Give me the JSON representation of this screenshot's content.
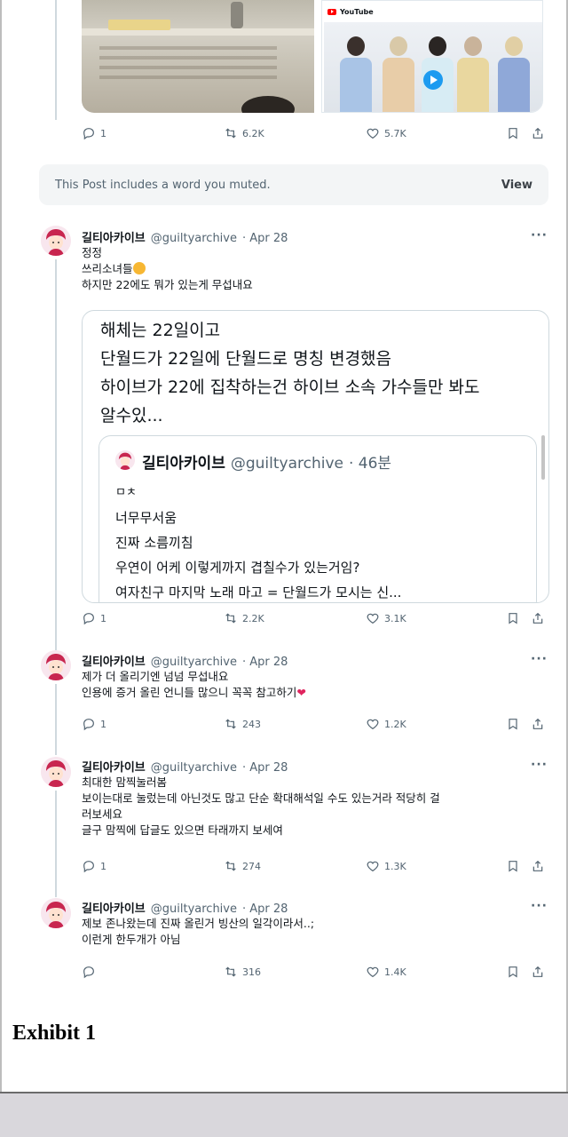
{
  "top_media": {
    "youtube_label": "YouTube"
  },
  "muted_notice": {
    "text": "This Post includes a word you muted.",
    "view_label": "View"
  },
  "actions_rows": [
    {
      "replies": "1",
      "reposts": "6.2K",
      "likes": "5.7K"
    },
    {
      "replies": "1",
      "reposts": "2.2K",
      "likes": "3.1K"
    },
    {
      "replies": "1",
      "reposts": "243",
      "likes": "1.2K"
    },
    {
      "replies": "1",
      "reposts": "274",
      "likes": "1.3K"
    },
    {
      "replies": "",
      "reposts": "316",
      "likes": "1.4K"
    }
  ],
  "posts": [
    {
      "name": "길티아카이브",
      "handle": "@guiltyarchive",
      "date": "· Apr 28",
      "lines": [
        "정정",
        "쓰리소녀들",
        "하지만 22에도 뭐가 있는게 무섭내요"
      ]
    },
    {
      "name": "길티아카이브",
      "handle": "@guiltyarchive",
      "date": "· Apr 28",
      "lines": [
        "제가 더 올리기엔 넘넘 무섭내요",
        "인용에 증거 올린 언니들 많으니 꼭꼭 참고하기"
      ]
    },
    {
      "name": "길티아카이브",
      "handle": "@guiltyarchive",
      "date": "· Apr 28",
      "lines": [
        "최대한 맘찍눌러봄",
        "보이는대로 눌렀는데 아닌것도 많고 단순 확대해석일 수도 있는거라 적당히 걸",
        "러보세요",
        "글구 맘찍에 답글도 있으면 타래까지 보세여"
      ]
    },
    {
      "name": "길티아카이브",
      "handle": "@guiltyarchive",
      "date": "· Apr 28",
      "lines": [
        "제보 존나왔는데 진짜 올린거 빙산의 일각이라서..;",
        "이런게 한두개가 아님"
      ]
    }
  ],
  "quote": {
    "lines": [
      "해체는 22일이고",
      "단월드가 22일에 단월드로 명칭 변경했음",
      "하이브가 22에 집착하는건 하이브 소속 가수들만 봐도",
      "알수있..."
    ],
    "inner": {
      "name": "길티아카이브",
      "handle": "@guiltyarchive",
      "time": "· 46분",
      "lines": [
        "ㅁㅊ",
        "너무무서움",
        "진짜 소름끼침",
        "우연이 어케 이렇게까지 겹칠수가 있는거임?",
        "여자친구 마지막 노래 마고 = 단월드가 모시는 신..."
      ]
    }
  },
  "exhibit_label": "Exhibit 1",
  "colors": {
    "text_primary": "#0f1419",
    "text_secondary": "#536471",
    "border": "#cfd9de",
    "heart": "#e0245e",
    "youtube_red": "#ff0000"
  }
}
